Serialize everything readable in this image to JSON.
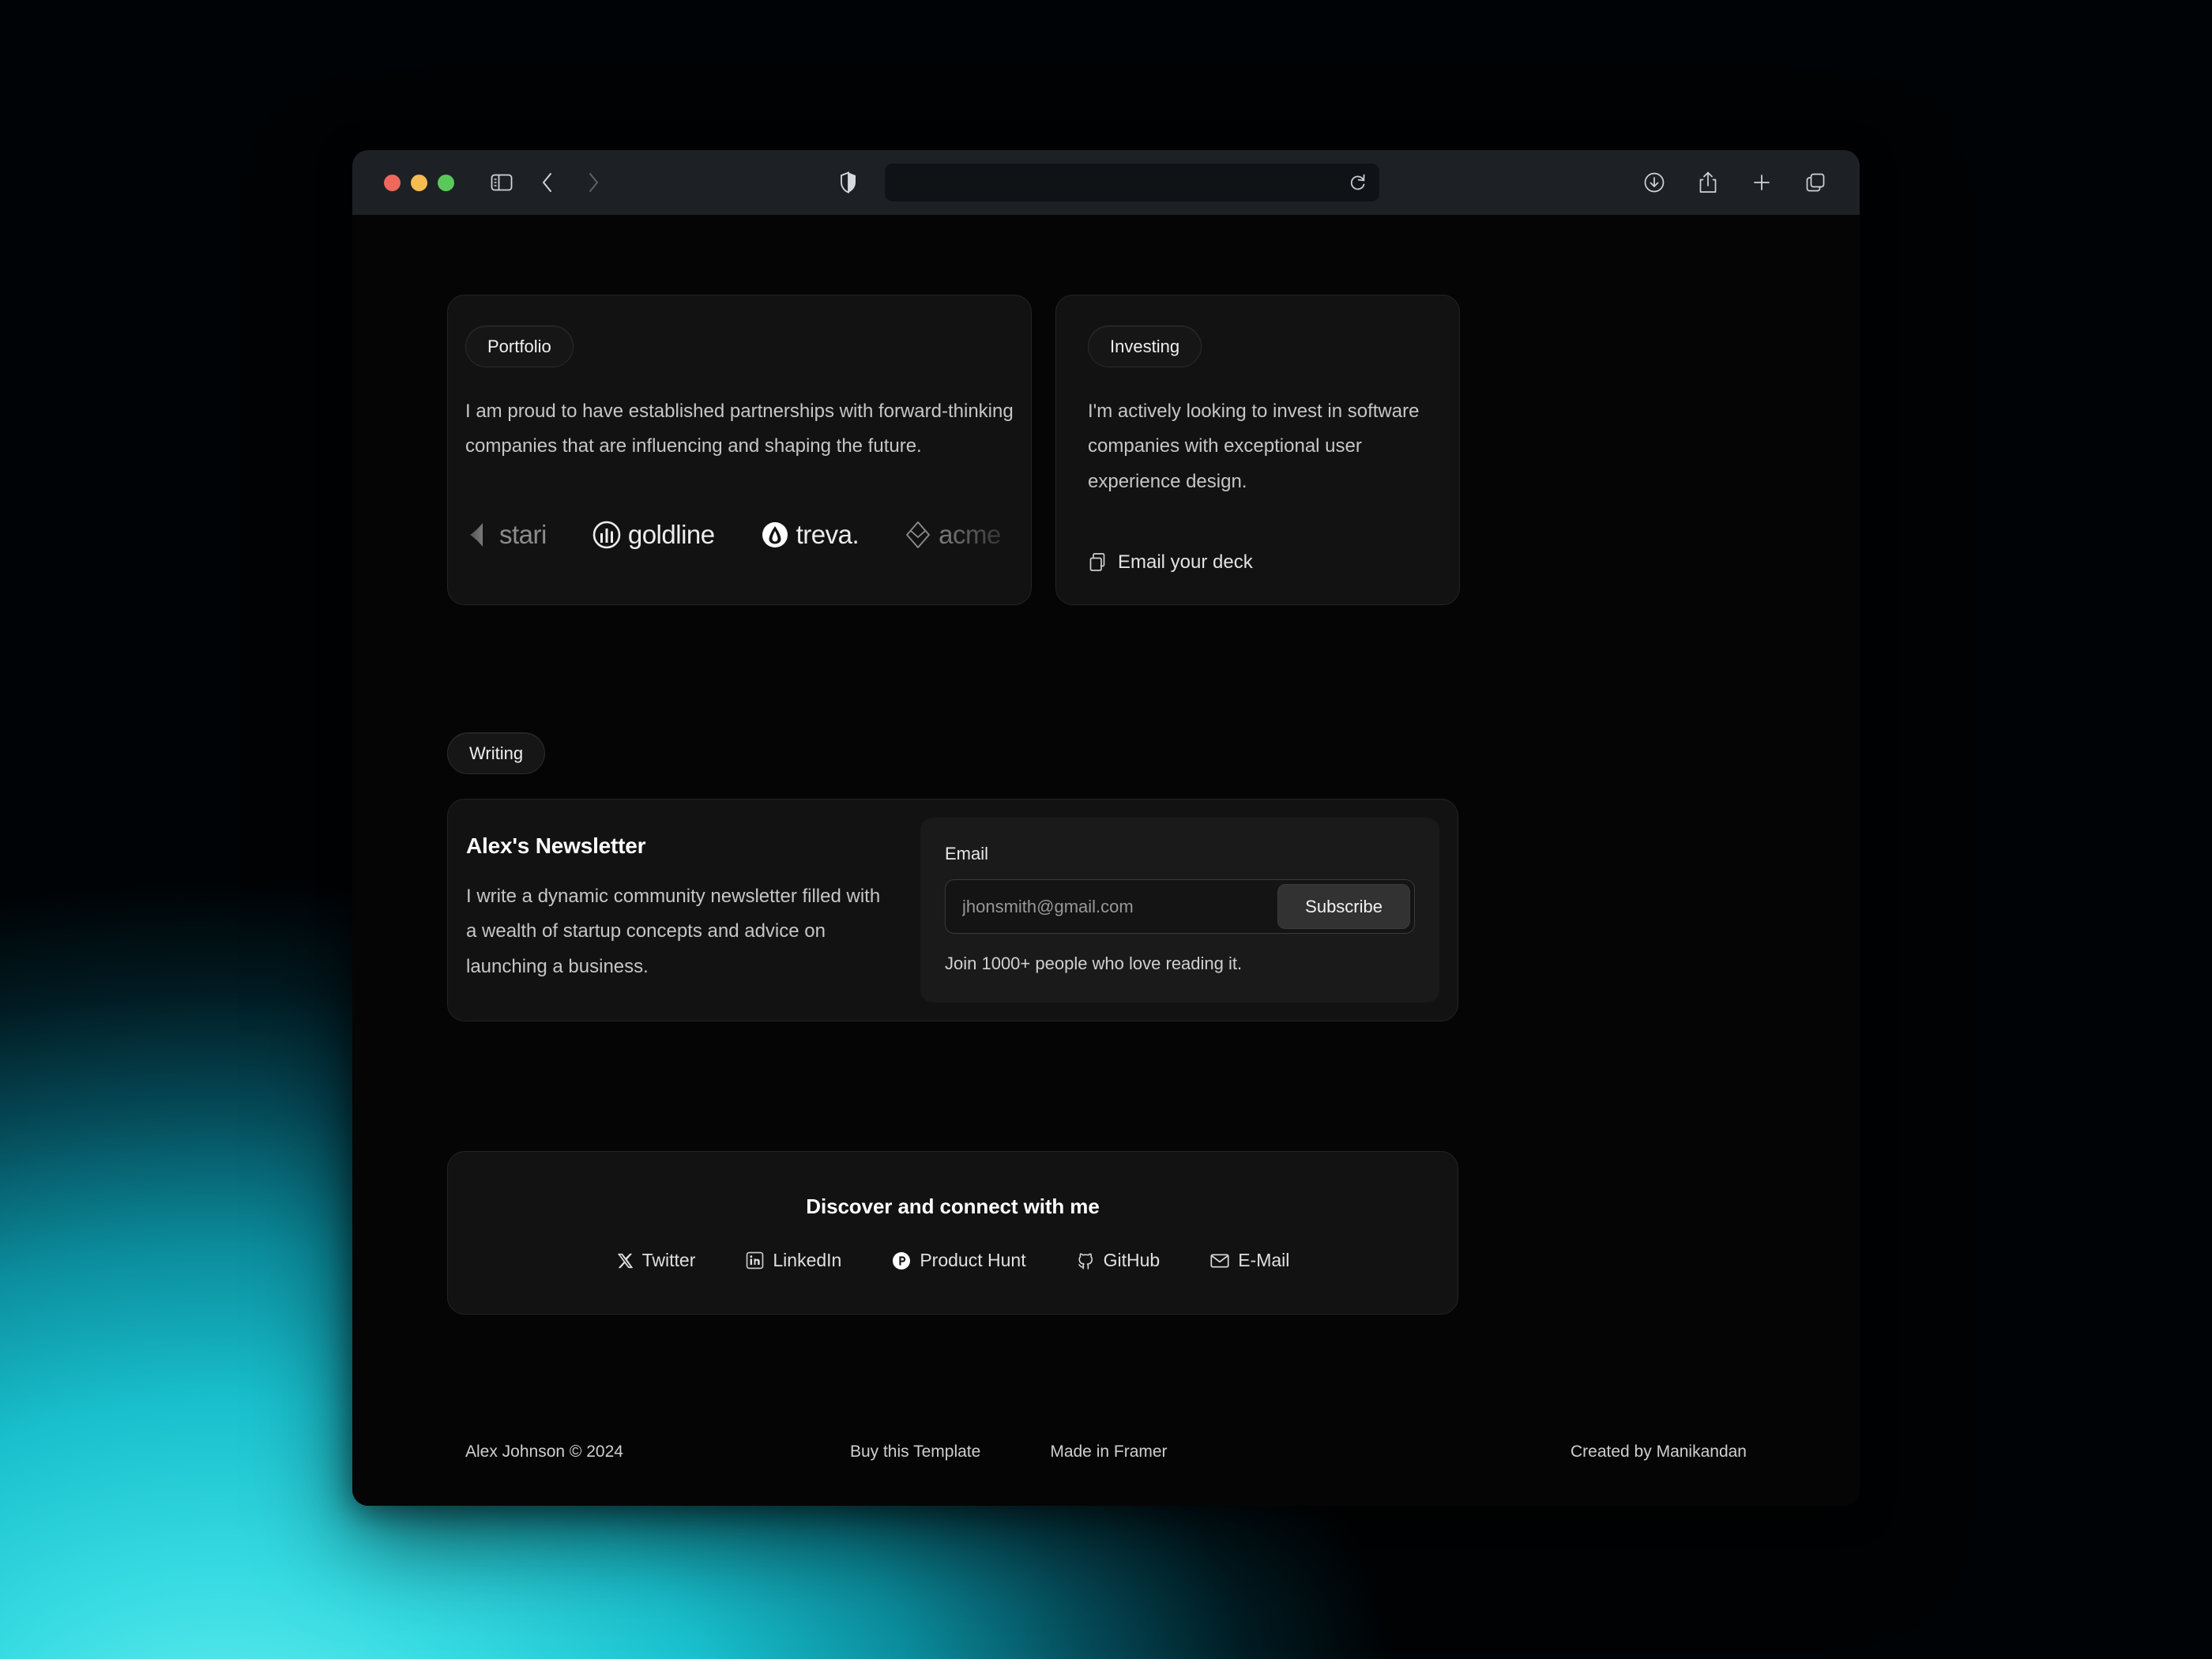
{
  "browser": {
    "traffic_lights": [
      "close",
      "minimize",
      "maximize"
    ],
    "sidebar_toggle_icon": "sidebar-icon",
    "back_icon": "chevron-left-icon",
    "forward_icon": "chevron-right-icon",
    "shield_icon": "privacy-shield-icon",
    "url_value": "",
    "url_placeholder": "",
    "reload_icon": "reload-icon",
    "right_icons": [
      "download-icon",
      "share-icon",
      "new-tab-icon",
      "tab-overview-icon"
    ]
  },
  "portfolio": {
    "pill_label": "Portfolio",
    "body": "I am proud to have established partnerships with forward-thinking companies that are influencing and shaping the future.",
    "logos": [
      {
        "name": "stari",
        "icon": "stari-mark-icon",
        "muted": true
      },
      {
        "name": "goldline",
        "icon": "goldline-mark-icon",
        "muted": false
      },
      {
        "name": "treva.",
        "icon": "treva-mark-icon",
        "muted": false
      },
      {
        "name": "acme",
        "icon": "acme-mark-icon",
        "muted": true
      }
    ]
  },
  "investing": {
    "pill_label": "Investing",
    "body": "I'm actively looking to invest in software companies with exceptional user experience design.",
    "cta_label": "Email your deck",
    "cta_icon": "copy-icon"
  },
  "writing": {
    "pill_label": "Writing",
    "newsletter_title": "Alex's Newsletter",
    "newsletter_desc": "I write a dynamic community newsletter filled with a wealth of startup concepts and advice on launching a business.",
    "email_label": "Email",
    "email_value": "",
    "email_placeholder": "jhonsmith@gmail.com",
    "subscribe_label": "Subscribe",
    "join_note": "Join 1000+ people who love reading it."
  },
  "connect": {
    "title": "Discover and connect with me",
    "links": [
      {
        "label": "Twitter",
        "icon": "x-twitter-icon"
      },
      {
        "label": "LinkedIn",
        "icon": "linkedin-icon"
      },
      {
        "label": "Product Hunt",
        "icon": "product-hunt-icon"
      },
      {
        "label": "GitHub",
        "icon": "github-icon"
      },
      {
        "label": "E-Mail",
        "icon": "envelope-icon"
      }
    ]
  },
  "footer": {
    "copyright": "Alex Johnson © 2024",
    "links": [
      "Buy this Template",
      "Made in Framer"
    ],
    "credit": "Created by Manikandan"
  },
  "colors": {
    "desktop_glow": "#2DD4DC",
    "window_bg": "#050505",
    "toolbar_bg": "#1D2125",
    "card_bg": "#121212",
    "card_border": "#232323",
    "subscribe_bg": "#323232"
  }
}
